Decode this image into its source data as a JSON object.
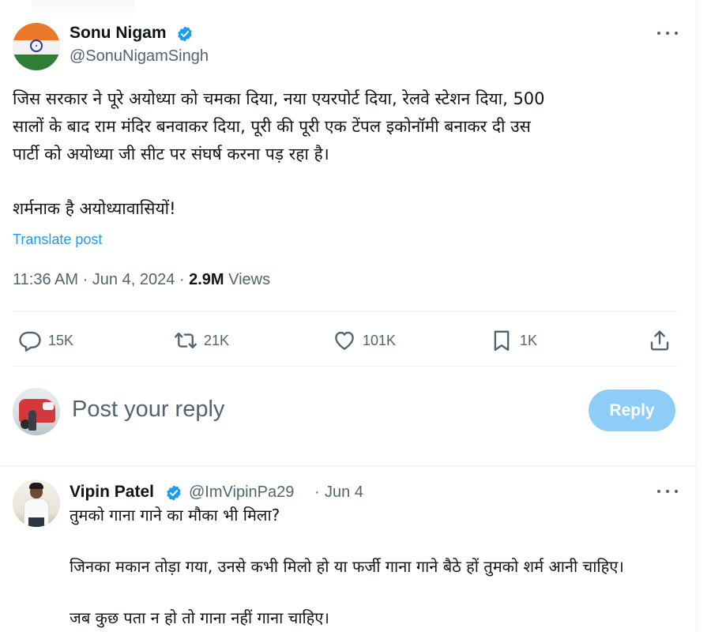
{
  "tweet": {
    "author": {
      "name": "Sonu Nigam",
      "handle": "@SonuNigamSingh"
    },
    "text_lines": [
      "जिस सरकार ने पूरे अयोध्या को चमका दिया, नया एयरपोर्ट दिया, रेलवे स्टेशन दिया, 500",
      "सालों के बाद राम मंदिर बनवाकर दिया, पूरी की पूरी एक टेंपल इकोनॉमी बनाकर दी उस",
      "पार्टी को अयोध्या जी सीट पर संघर्ष करना पड़ रहा है।"
    ],
    "text_line_2": "शर्मनाक है अयोध्यावासियों!",
    "translate_label": "Translate post",
    "timestamp": "11:36 AM · Jun 4, 2024 · ",
    "views_count": "2.9M",
    "views_label": " Views",
    "actions": {
      "replies": "15K",
      "reposts": "21K",
      "likes": "101K",
      "bookmarks": "1K"
    },
    "icons": {
      "reply": "reply-icon",
      "repost": "repost-icon",
      "like": "heart-icon",
      "bookmark": "bookmark-icon",
      "share": "share-icon",
      "verified": "verified-badge-icon",
      "more": "more-icon"
    }
  },
  "composer": {
    "placeholder": "Post your reply",
    "button_label": "Reply"
  },
  "reply": {
    "author": {
      "name": "Vipin Patel",
      "handle": "@ImVipinPa29",
      "separator": "·",
      "date": "Jun 4"
    },
    "line1": "तुमको गाना गाने का मौका भी मिला?",
    "line2": "जिनका मकान तोड़ा गया, उनसे कभी मिलो हो या फर्जी गाना गाने बैठे हों तुमको शर्म आनी चाहिए।",
    "line3": "जब कुछ पता न हो तो गाना नहीं गाना चाहिए।"
  },
  "colors": {
    "accent": "#1d9bf0",
    "reply_button_disabled": "#8ecdf8",
    "secondary_text": "#536471",
    "primary_text": "#0f1419",
    "divider": "#eff3f4"
  }
}
